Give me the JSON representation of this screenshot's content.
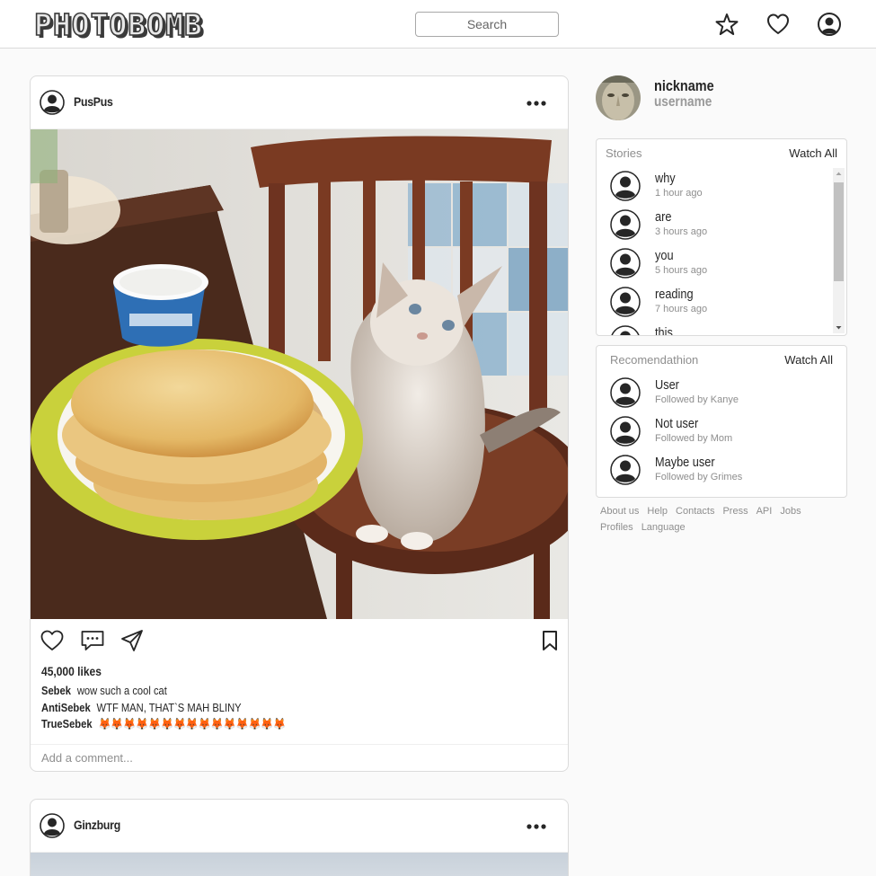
{
  "header": {
    "logo": "PHOTOBOMB",
    "search_placeholder": "Search"
  },
  "posts": [
    {
      "username": "PusPus",
      "likes": "45,000 likes",
      "comments": [
        {
          "user": "Sebek",
          "text": "wow such a cool cat"
        },
        {
          "user": "AntiSebek",
          "text": "WTF MAN, THAT`S MAH BLINY"
        },
        {
          "user": "TrueSebek",
          "text": "🦊🦊🦊🦊🦊🦊🦊🦊🦊🦊🦊🦊🦊🦊🦊"
        }
      ],
      "add_comment_placeholder": "Add a comment..."
    },
    {
      "username": "Ginzburg"
    }
  ],
  "profile": {
    "nickname": "nickname",
    "username": "username"
  },
  "stories": {
    "title": "Stories",
    "watch_all": "Watch All",
    "items": [
      {
        "name": "why",
        "time": "1 hour ago"
      },
      {
        "name": "are",
        "time": "3 hours ago"
      },
      {
        "name": "you",
        "time": "5 hours ago"
      },
      {
        "name": "reading",
        "time": "7 hours ago"
      },
      {
        "name": "this",
        "time": ""
      }
    ]
  },
  "recommendations": {
    "title": "Recomendathion",
    "watch_all": "Watch All",
    "items": [
      {
        "name": "User",
        "sub": "Followed by Kanye"
      },
      {
        "name": "Not user",
        "sub": "Followed by Mom"
      },
      {
        "name": "Maybe user",
        "sub": "Followed by Grimes"
      }
    ]
  },
  "footer": [
    "About us",
    "Help",
    "Contacts",
    "Press",
    "API",
    "Jobs",
    "Profiles",
    "Language"
  ]
}
